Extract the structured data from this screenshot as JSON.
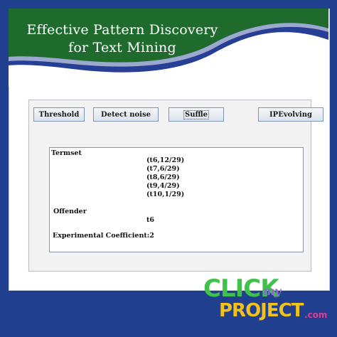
{
  "banner": {
    "title_line1": "Effective  Pattern  Discovery",
    "title_line2": "for Text Mining"
  },
  "buttons": {
    "threshold": "Threshold",
    "detect_noise": "Detect noise",
    "suffle": "Suffle",
    "ipevolving": "IPEvolving"
  },
  "output": {
    "termset_label": "Termset",
    "terms": [
      "(t6,12/29)",
      "(t7,6/29)",
      "(t8,6/29)",
      "(t9,4/29)",
      "(t10,1/29)"
    ],
    "offender_label": "Offender",
    "offender_value": "t6",
    "coefficient_label": "Experimental Coefficient:2"
  },
  "logo": {
    "click": "CLICK",
    "my": "my",
    "project": "PROJECT",
    "com": ".com"
  },
  "colors": {
    "frame_blue": "#213f8f",
    "banner_green": "#1f6b2e",
    "banner_blue": "#263f94"
  }
}
